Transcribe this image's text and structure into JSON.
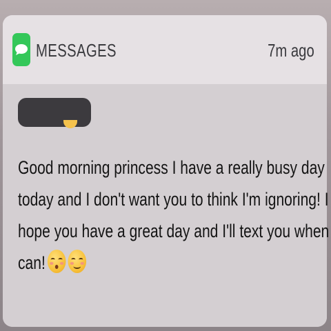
{
  "notification": {
    "app_name": "MESSAGES",
    "time": "7m ago",
    "app_icon": "messages-bubble-icon",
    "accent_color": "#34c759",
    "message_lines": [
      "Good morning princess I have a really busy day",
      "today and I don't want you to think I'm ignoring! I",
      "hope you have a great day and I'll text you when I",
      "can!"
    ],
    "trailing_emojis": [
      "kissing-face-with-closed-eyes-emoji",
      "smiling-face-emoji"
    ]
  }
}
